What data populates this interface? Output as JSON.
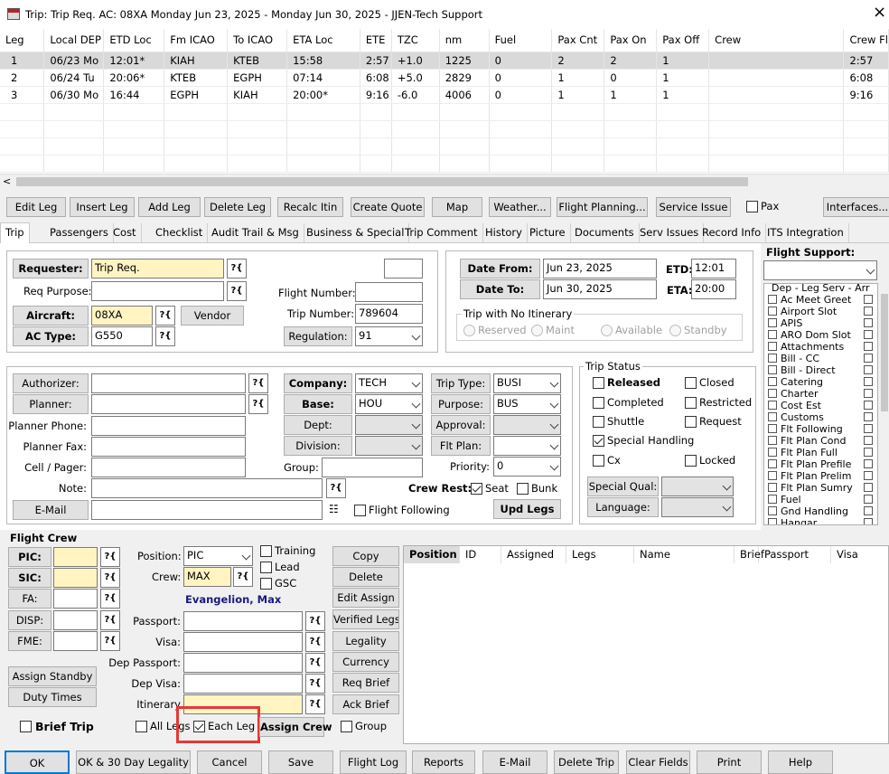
{
  "window": {
    "title": "Trip: Trip Req.  AC: 08XA  Monday Jun 23, 2025 - Monday Jun 30, 2025 - JJEN-Tech Support",
    "close": "×"
  },
  "legs_table": {
    "columns": [
      "Leg",
      "Local DEP",
      "ETD Loc",
      "Fm ICAO",
      "To ICAO",
      "ETA Loc",
      "ETE",
      "TZC",
      "nm",
      "Fuel",
      "Pax Cnt",
      "Pax On",
      "Pax Off",
      "Crew",
      "Crew Fl"
    ],
    "rows": [
      [
        "1",
        "06/23 Mo",
        "12:01*",
        "KIAH",
        "KTEB",
        "15:58",
        "2:57",
        "+1.0",
        "1225",
        "0",
        "2",
        "2",
        "1",
        "",
        "2:57"
      ],
      [
        "2",
        "06/24 Tu",
        "20:06*",
        "KTEB",
        "EGPH",
        "07:14",
        "6:08",
        "+5.0",
        "2829",
        "0",
        "1",
        "0",
        "1",
        "",
        "6:08"
      ],
      [
        "3",
        "06/30 Mo",
        "16:44",
        "EGPH",
        "KIAH",
        "20:00*",
        "9:16",
        "-6.0",
        "4006",
        "0",
        "1",
        "1",
        "1",
        "",
        "9:16"
      ]
    ]
  },
  "toolbar": {
    "buttons": [
      "Edit Leg",
      "Insert Leg",
      "Add Leg",
      "Delete Leg",
      "Recalc Itin",
      "Create Quote",
      "Map",
      "Weather...",
      "Flight Planning...",
      "Service Issue"
    ],
    "pax_label": "Pax",
    "interfaces": "Interfaces..."
  },
  "tabs": [
    "Trip",
    "Passengers",
    "Cost",
    "Checklist",
    "Audit Trail & Msg",
    "Business & Special",
    "Trip Comment",
    "History",
    "Picture",
    "Documents",
    "Serv Issues",
    "Record Info",
    "ITS Integration"
  ],
  "trip": {
    "requester_label": "Requester:",
    "requester_value": "Trip Req.",
    "req_purpose_label": "Req Purpose:",
    "aircraft_label": "Aircraft:",
    "aircraft_value": "08XA",
    "vendor_label": "Vendor",
    "actype_label": "AC Type:",
    "actype_value": "G550",
    "flight_number_label": "Flight Number:",
    "flight_number_value": "",
    "trip_number_label": "Trip Number:",
    "trip_number_value": "789604",
    "regulation_label": "Regulation:",
    "regulation_value": "91",
    "date_from_label": "Date From:",
    "date_from_value": "Jun 23, 2025",
    "date_to_label": "Date To:",
    "date_to_value": "Jun 30, 2025",
    "etd_label": "ETD:",
    "etd_value": "12:01",
    "eta_label": "ETA:",
    "eta_value": "20:00",
    "no_itin_label": "Trip with No Itinerary",
    "radios": [
      "Reserved",
      "Maint",
      "Available",
      "Standby"
    ]
  },
  "details": {
    "authorizer": "Authorizer:",
    "planner": "Planner:",
    "planner_phone": "Planner Phone:",
    "planner_fax": "Planner Fax:",
    "cell": "Cell / Pager:",
    "note": "Note:",
    "email": "E-Mail",
    "company_label": "Company:",
    "company_value": "TECH",
    "base_label": "Base:",
    "base_value": "HOU",
    "dept_label": "Dept:",
    "division_label": "Division:",
    "group_label": "Group:",
    "trip_type_label": "Trip Type:",
    "trip_type_value": "BUSI",
    "purpose_label": "Purpose:",
    "purpose_value": "BUS",
    "approval_label": "Approval:",
    "flt_plan_label": "Flt Plan:",
    "priority_label": "Priority:",
    "priority_value": "0",
    "crew_rest_label": "Crew Rest:",
    "seat_label": "Seat",
    "bunk_label": "Bunk",
    "flight_following_label": "Flight Following",
    "upd_legs": "Upd Legs"
  },
  "status": {
    "title": "Trip Status",
    "left": [
      {
        "label": "Released",
        "checked": false,
        "bold": true
      },
      {
        "label": "Completed",
        "checked": false
      },
      {
        "label": "Shuttle",
        "checked": false
      },
      {
        "label": "Special Handling",
        "checked": true
      },
      {
        "label": "Cx",
        "checked": false
      }
    ],
    "right": [
      {
        "label": "Closed",
        "checked": false
      },
      {
        "label": "Restricted",
        "checked": false
      },
      {
        "label": "Request",
        "checked": false
      },
      {
        "label": "Locked",
        "checked": false
      }
    ],
    "special_qual": "Special Qual:",
    "language": "Language:"
  },
  "flight_support": {
    "title": "Flight Support:",
    "header": "Dep - Leg Serv - Arr",
    "items": [
      "Ac Meet Greet",
      "Airport Slot",
      "APIS",
      "ARO Dom Slot",
      "Attachments",
      "Bill - CC",
      "Bill - Direct",
      "Catering",
      "Charter",
      "Cost Est",
      "Customs",
      "Flt Following",
      "Flt Plan Cond",
      "Flt Plan Full",
      "Flt Plan Prefile",
      "Flt Plan Prelim",
      "Flt Plan Sumry",
      "Fuel",
      "Gnd Handling",
      "Hangar"
    ]
  },
  "crew": {
    "title": "Flight Crew",
    "roles": [
      "PIC:",
      "SIC:",
      "FA:",
      "DISP:",
      "FME:"
    ],
    "position_label": "Position:",
    "position_value": "PIC",
    "crew_label": "Crew:",
    "crew_value": "MAX",
    "crew_name": "Evangelion, Max",
    "training": "Training",
    "lead": "Lead",
    "gsc": "GSC",
    "passport": "Passport:",
    "visa": "Visa:",
    "dep_passport": "Dep Passport:",
    "dep_visa": "Dep Visa:",
    "itinerary": "Itinerary",
    "assign_standby": "Assign Standby",
    "duty_times": "Duty Times",
    "brief_trip": "Brief Trip",
    "all_legs": "All Legs",
    "each_leg": "Each Leg",
    "assign_crew": "Assign Crew",
    "group": "Group",
    "side_buttons": [
      "Copy",
      "Delete",
      "Edit Assign",
      "Verified Legs",
      "Legality",
      "Currency",
      "Req Brief",
      "Ack Brief"
    ],
    "grid_columns": [
      "Position",
      "ID",
      "Assigned",
      "Legs",
      "Name",
      "Brief",
      "Passport",
      "Visa"
    ]
  },
  "bottom": [
    "OK",
    "OK & 30 Day Legality",
    "Cancel",
    "Save",
    "Flight Log",
    "Reports",
    "E-Mail",
    "Delete Trip",
    "Clear Fields",
    "Print",
    "Help"
  ],
  "colors": {
    "highlight": "#e53935",
    "yellow": "#fff4c2",
    "selected_row": "#d9d9d9",
    "name_blue": "#1a1a80"
  }
}
